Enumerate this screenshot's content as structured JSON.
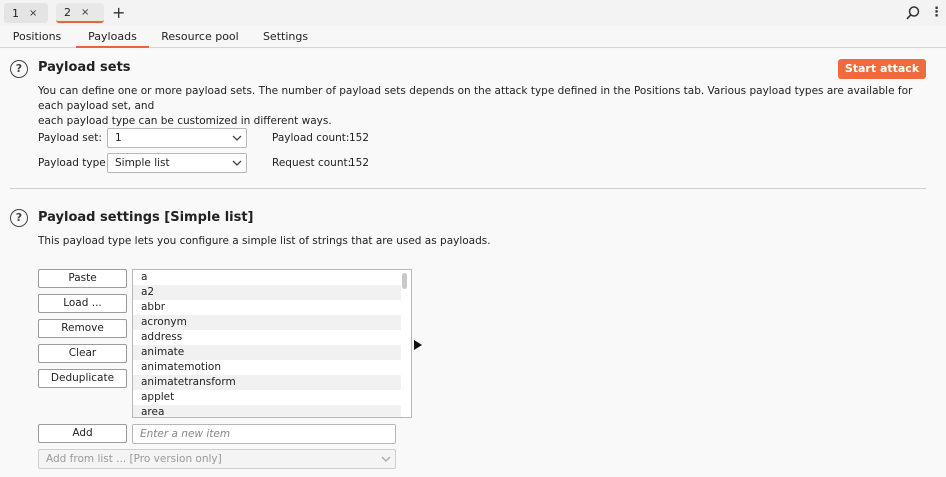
{
  "top_tabs": [
    {
      "label": "1",
      "close": "×"
    },
    {
      "label": "2",
      "close": "×"
    }
  ],
  "add_tab": "+",
  "sub_tabs": [
    "Positions",
    "Payloads",
    "Resource pool",
    "Settings"
  ],
  "payload_sets": {
    "title": "Payload sets",
    "description_line1": "You can define one or more payload sets. The number of payload sets depends on the attack type defined in the Positions tab. Various payload types are available for each payload set, and",
    "description_line2": "each payload type can be customized in different ways.",
    "payload_set_label": "Payload set:",
    "payload_set_value": "1",
    "payload_type_label": "Payload type:",
    "payload_type_value": "Simple list",
    "payload_count_label": "Payload count:",
    "payload_count_value": "152",
    "request_count_label": "Request count:",
    "request_count_value": "152",
    "start_attack": "Start attack"
  },
  "payload_settings": {
    "title": "Payload settings [Simple list]",
    "description": "This payload type lets you configure a simple list of strings that are used as payloads.",
    "buttons": {
      "paste": "Paste",
      "load": "Load ...",
      "remove": "Remove",
      "clear": "Clear",
      "deduplicate": "Deduplicate",
      "add": "Add"
    },
    "items": [
      "a",
      "a2",
      "abbr",
      "acronym",
      "address",
      "animate",
      "animatemotion",
      "animatetransform",
      "applet",
      "area"
    ],
    "new_item_placeholder": "Enter a new item",
    "add_from_list": "Add from list ... [Pro version only]"
  },
  "colors": {
    "accent": "#e8643c",
    "start_button": "#ee6c3c"
  },
  "icons": {
    "help": "?",
    "search": "search-icon",
    "menu": "⋮"
  }
}
